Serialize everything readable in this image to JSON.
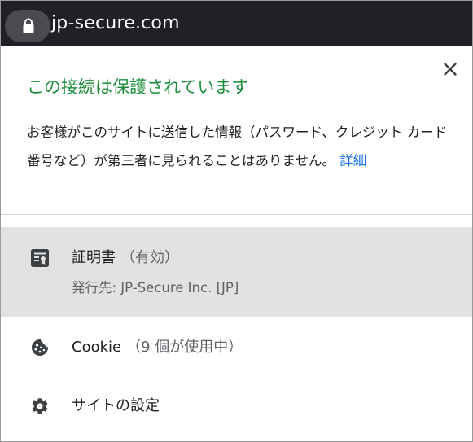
{
  "address_bar": {
    "domain": "jp-secure.com",
    "lock_icon": "lock-icon"
  },
  "popup": {
    "close_icon": "close-icon",
    "title": "この接続は保護されています",
    "description": "お客様がこのサイトに送信した情報（パスワード、クレジット カード番号など）が第三者に見られることはありません。",
    "detail_link": "詳細",
    "title_color": "#1e8e3e",
    "link_color": "#1a73e8"
  },
  "certificate": {
    "icon": "certificate-icon",
    "label": "証明書",
    "status": "（有効）",
    "issuer": "発行先: JP-Secure Inc. [JP]",
    "highlight_color": "#e2e2e2"
  },
  "cookie": {
    "icon": "cookie-icon",
    "label": "Cookie",
    "count": "（9 個が使用中）"
  },
  "site_settings": {
    "icon": "gear-icon",
    "label": "サイトの設定"
  }
}
